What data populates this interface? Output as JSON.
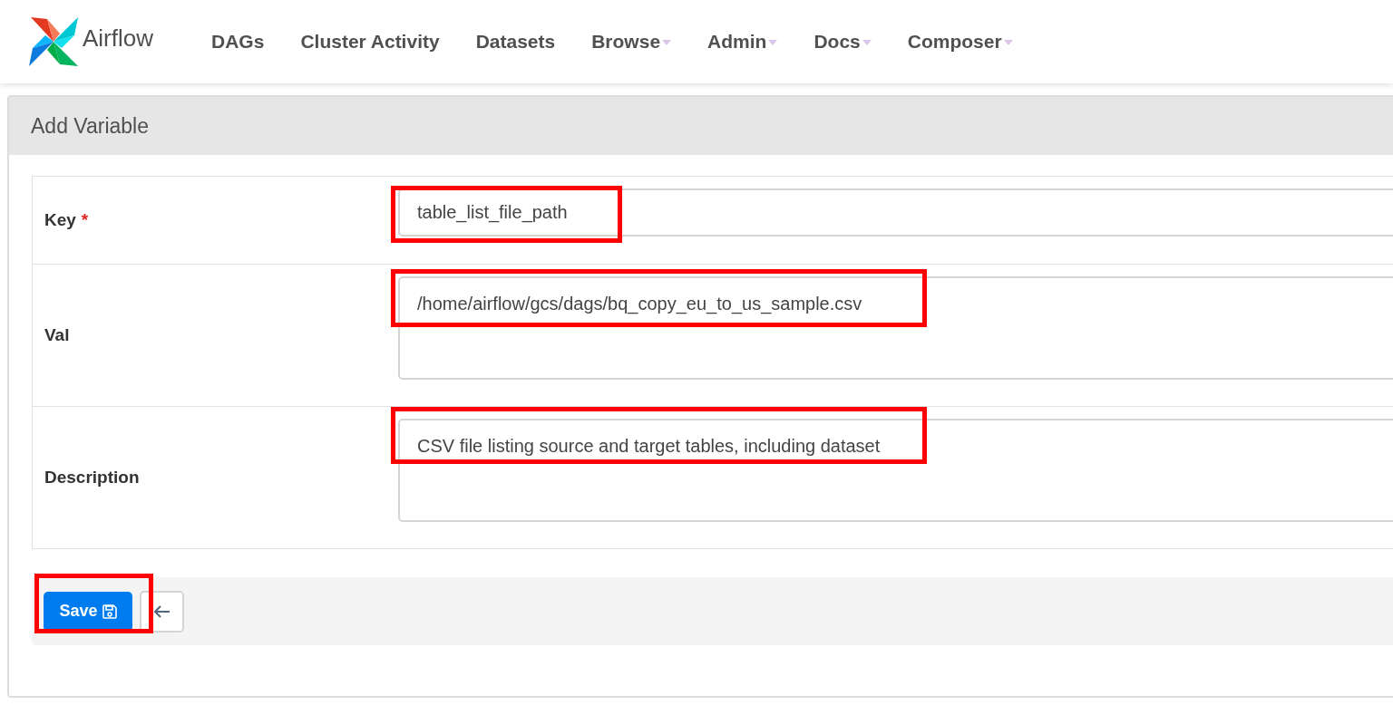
{
  "brand": "Airflow",
  "nav": [
    {
      "label": "DAGs",
      "dropdown": false
    },
    {
      "label": "Cluster Activity",
      "dropdown": false
    },
    {
      "label": "Datasets",
      "dropdown": false
    },
    {
      "label": "Browse",
      "dropdown": true
    },
    {
      "label": "Admin",
      "dropdown": true
    },
    {
      "label": "Docs",
      "dropdown": true
    },
    {
      "label": "Composer",
      "dropdown": true
    }
  ],
  "panel": {
    "title": "Add Variable"
  },
  "fields": [
    {
      "label": "Key",
      "required_mark": "*",
      "kind": "input",
      "value": "table_list_file_path",
      "highlighted": true
    },
    {
      "label": "Val",
      "kind": "textarea",
      "value": "/home/airflow/gcs/dags/bq_copy_eu_to_us_sample.csv",
      "highlighted": true
    },
    {
      "label": "Description",
      "kind": "textarea",
      "value": "CSV file listing source and target tables, including dataset",
      "highlighted": true
    }
  ],
  "save_button": {
    "label": "Save",
    "highlighted": true
  }
}
